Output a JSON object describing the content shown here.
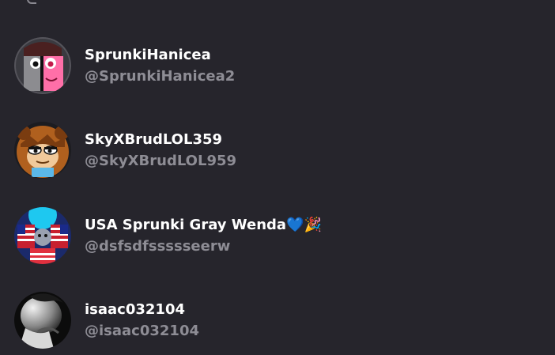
{
  "users": [
    {
      "display_name": "SprunkiHanicea",
      "username": "@SprunkiHanicea2",
      "avatar_icon": "sprunki-pink-character-avatar"
    },
    {
      "display_name": "SkyXBrudLOL359",
      "username": "@SkyXBrudLOL959",
      "avatar_icon": "brown-bear-character-avatar"
    },
    {
      "display_name": "USA Sprunki Gray Wenda💙🎉",
      "username": "@dsfsdfssssseerw",
      "avatar_icon": "usa-flag-character-avatar"
    },
    {
      "display_name": "isaac032104",
      "username": "@isaac032104",
      "avatar_icon": "grayscale-person-photo-avatar"
    }
  ],
  "colors": {
    "background": "#26252c",
    "display_name": "#ffffff",
    "username": "#8e8d95"
  }
}
